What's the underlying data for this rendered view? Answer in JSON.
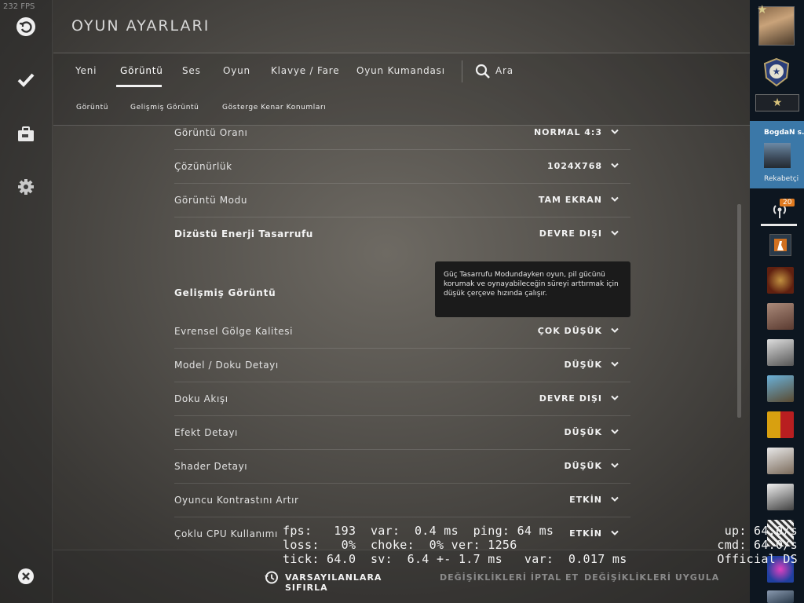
{
  "fps_counter": "232 FPS",
  "page_title": "OYUN AYARLARI",
  "tabs": [
    {
      "label": "Yeni"
    },
    {
      "label": "Görüntü"
    },
    {
      "label": "Ses"
    },
    {
      "label": "Oyun"
    },
    {
      "label": "Klavye / Fare"
    },
    {
      "label": "Oyun Kumandası"
    }
  ],
  "search_label": "Ara",
  "subtabs": [
    {
      "label": "Görüntü"
    },
    {
      "label": "Gelişmiş Görüntü"
    },
    {
      "label": "Gösterge Kenar Konumları"
    }
  ],
  "settings": [
    {
      "label": "Görüntü Oranı",
      "value": "NORMAL 4:3"
    },
    {
      "label": "Çözünürlük",
      "value": "1024X768"
    },
    {
      "label": "Görüntü Modu",
      "value": "TAM EKRAN"
    },
    {
      "label": "Dizüstü Enerji Tasarrufu",
      "value": "DEVRE DIŞI"
    }
  ],
  "advanced_section_title": "Gelişmiş Görüntü",
  "advanced_settings": [
    {
      "label": "Evrensel Gölge Kalitesi",
      "value": "ÇOK DÜŞÜK"
    },
    {
      "label": "Model / Doku Detayı",
      "value": "DÜŞÜK"
    },
    {
      "label": "Doku Akışı",
      "value": "DEVRE DIŞI"
    },
    {
      "label": "Efekt Detayı",
      "value": "DÜŞÜK"
    },
    {
      "label": "Shader Detayı",
      "value": "DÜŞÜK"
    },
    {
      "label": "Oyuncu Kontrastını Artır",
      "value": "ETKİN"
    },
    {
      "label": "Çoklu CPU Kullanımı",
      "value": "ETKİN"
    }
  ],
  "tooltip_text": "Güç Tasarrufu Modundayken oyun, pil gücünü korumak ve oynayabileceğin süreyi arttırmak için düşük çerçeve hızında çalışır.",
  "bottom": {
    "reset_label": "VARSAYILANLARA SIFIRLA",
    "cancel_label": "DEĞİŞİKLİKLERİ İPTAL ET",
    "apply_label": "DEĞİŞİKLİKLERİ UYGULA"
  },
  "netgraph": {
    "line1": "fps:   193  var:  0.4 ms  ping: 64 ms",
    "line2": "loss:   0%  choke:  0% ver: 1256",
    "line3": "tick: 64.0  sv:  6.4 +- 1.7 ms   var:  0.017 ms",
    "right1": "up: 64.0/s",
    "right2": "cmd: 64.0/s",
    "right3": "Official DS"
  },
  "right_panel": {
    "username": "BogdaN s.",
    "rank_label": "Rekabetçi",
    "notification_count": "20"
  },
  "colors": {
    "profile_card": "#3b78a8",
    "badge_orange": "#e07a1f",
    "panel_bg": "#0d1620"
  }
}
